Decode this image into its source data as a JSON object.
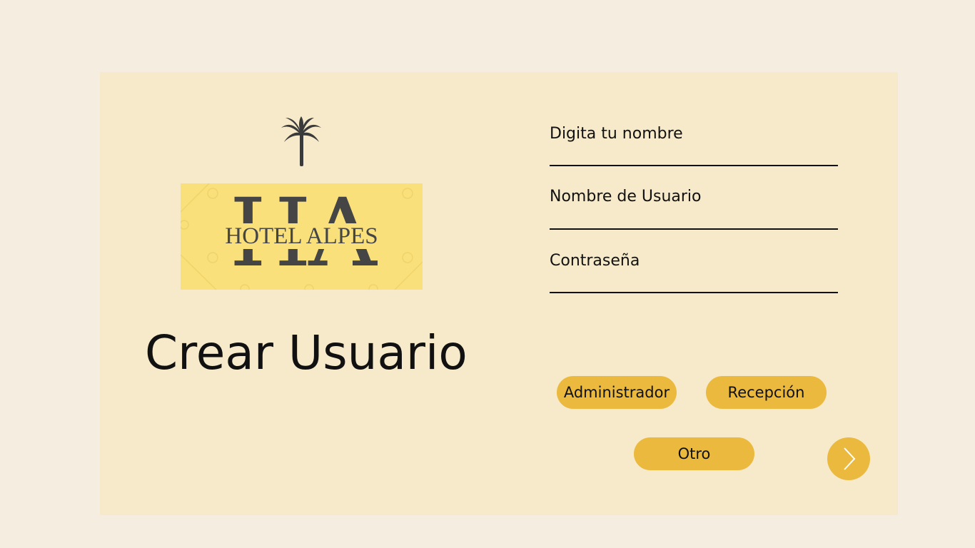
{
  "logo": {
    "monogram": "HA",
    "name": "HOTEL ALPES",
    "icon": "palm-tree-icon"
  },
  "page_title": "Crear Usuario",
  "form": {
    "fields": [
      {
        "label": "Digita tu nombre",
        "value": ""
      },
      {
        "label": "Nombre de Usuario",
        "value": ""
      },
      {
        "label": "Contraseña",
        "value": ""
      }
    ]
  },
  "roles": {
    "admin_label": "Administrador",
    "reception_label": "Recepción",
    "other_label": "Otro"
  },
  "next_button": {
    "icon": "chevron-right-icon"
  },
  "colors": {
    "page_bg": "#f5ede0",
    "card_bg": "#f6eaca",
    "logo_bg": "#f9e07a",
    "accent": "#ebb93e",
    "text": "#111111",
    "logo_ink": "#454545"
  }
}
